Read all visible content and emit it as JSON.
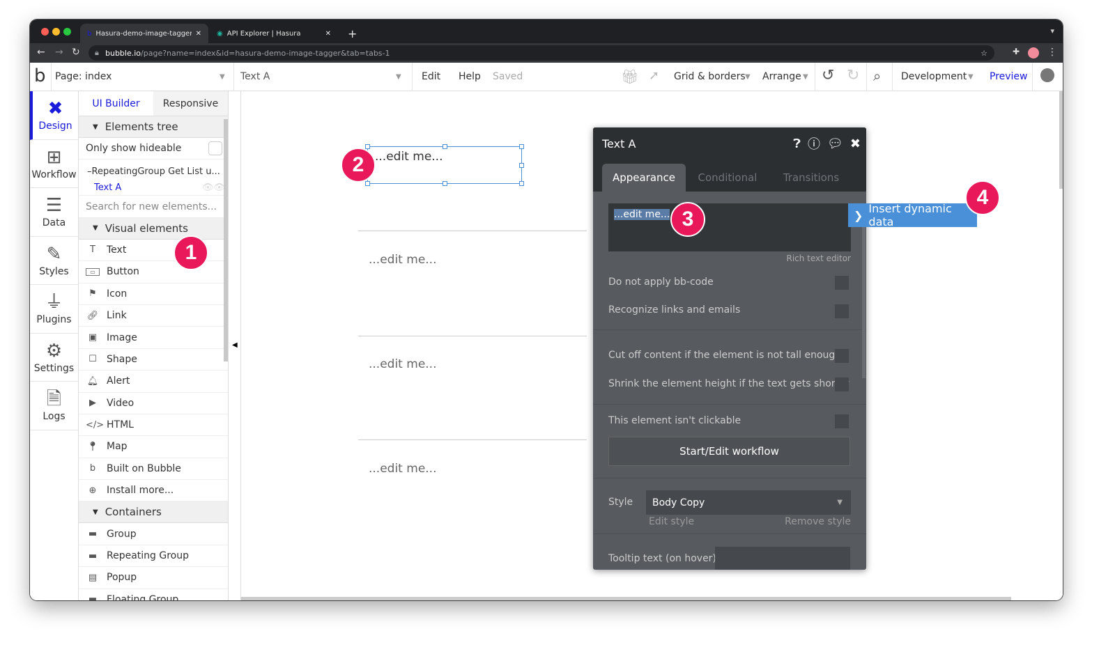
{
  "browser": {
    "tabs": [
      {
        "title": "Hasura-demo-image-tagger | B"
      },
      {
        "title": "API Explorer | Hasura"
      }
    ],
    "url_host": "bubble.io",
    "url_path": "/page?name=index&id=hasura-demo-image-tagger&tab=tabs-1"
  },
  "appbar": {
    "page": "Page: index",
    "element": "Text A",
    "edit": "Edit",
    "help": "Help",
    "saved": "Saved",
    "grid": "Grid & borders",
    "arrange": "Arrange",
    "env": "Development",
    "preview": "Preview"
  },
  "rail": [
    {
      "label": "Design",
      "icon": "design-icon"
    },
    {
      "label": "Workflow",
      "icon": "workflow-icon"
    },
    {
      "label": "Data",
      "icon": "database-icon"
    },
    {
      "label": "Styles",
      "icon": "brush-icon"
    },
    {
      "label": "Plugins",
      "icon": "plug-icon"
    },
    {
      "label": "Settings",
      "icon": "gear-icon"
    },
    {
      "label": "Logs",
      "icon": "document-icon"
    }
  ],
  "panel": {
    "tabs": [
      "UI Builder",
      "Responsive"
    ],
    "elements_tree": "Elements tree",
    "only_hideable": "Only show hideable",
    "tree": [
      "RepeatingGroup Get List u...",
      "Text A"
    ],
    "search_placeholder": "Search for new elements...",
    "visual_header": "Visual elements",
    "visual": [
      "Text",
      "Button",
      "Icon",
      "Link",
      "Image",
      "Shape",
      "Alert",
      "Video",
      "HTML",
      "Map",
      "Built on Bubble",
      "Install more..."
    ],
    "containers_header": "Containers",
    "containers": [
      "Group",
      "Repeating Group",
      "Popup",
      "Floating Group"
    ]
  },
  "canvas": {
    "placeholder": "...edit me..."
  },
  "badges": [
    "1",
    "2",
    "3",
    "4"
  ],
  "prop": {
    "title": "Text A",
    "tabs": [
      "Appearance",
      "Conditional",
      "Transitions"
    ],
    "content": "...edit me...",
    "insert": "Insert dynamic data",
    "rich": "Rich text editor",
    "checks": [
      "Do not apply bb-code",
      "Recognize links and emails",
      "Cut off content if the element is not tall enough",
      "Shrink the element height if the text gets shorter",
      "This element isn't clickable"
    ],
    "workflow_btn": "Start/Edit workflow",
    "style_label": "Style",
    "style_value": "Body Copy",
    "edit_style": "Edit style",
    "remove_style": "Remove style",
    "tooltip": "Tooltip text (on hover)"
  },
  "colors": {
    "accent": "#1a1adb",
    "badge": "#e8185a",
    "insert": "#4a90d9"
  }
}
